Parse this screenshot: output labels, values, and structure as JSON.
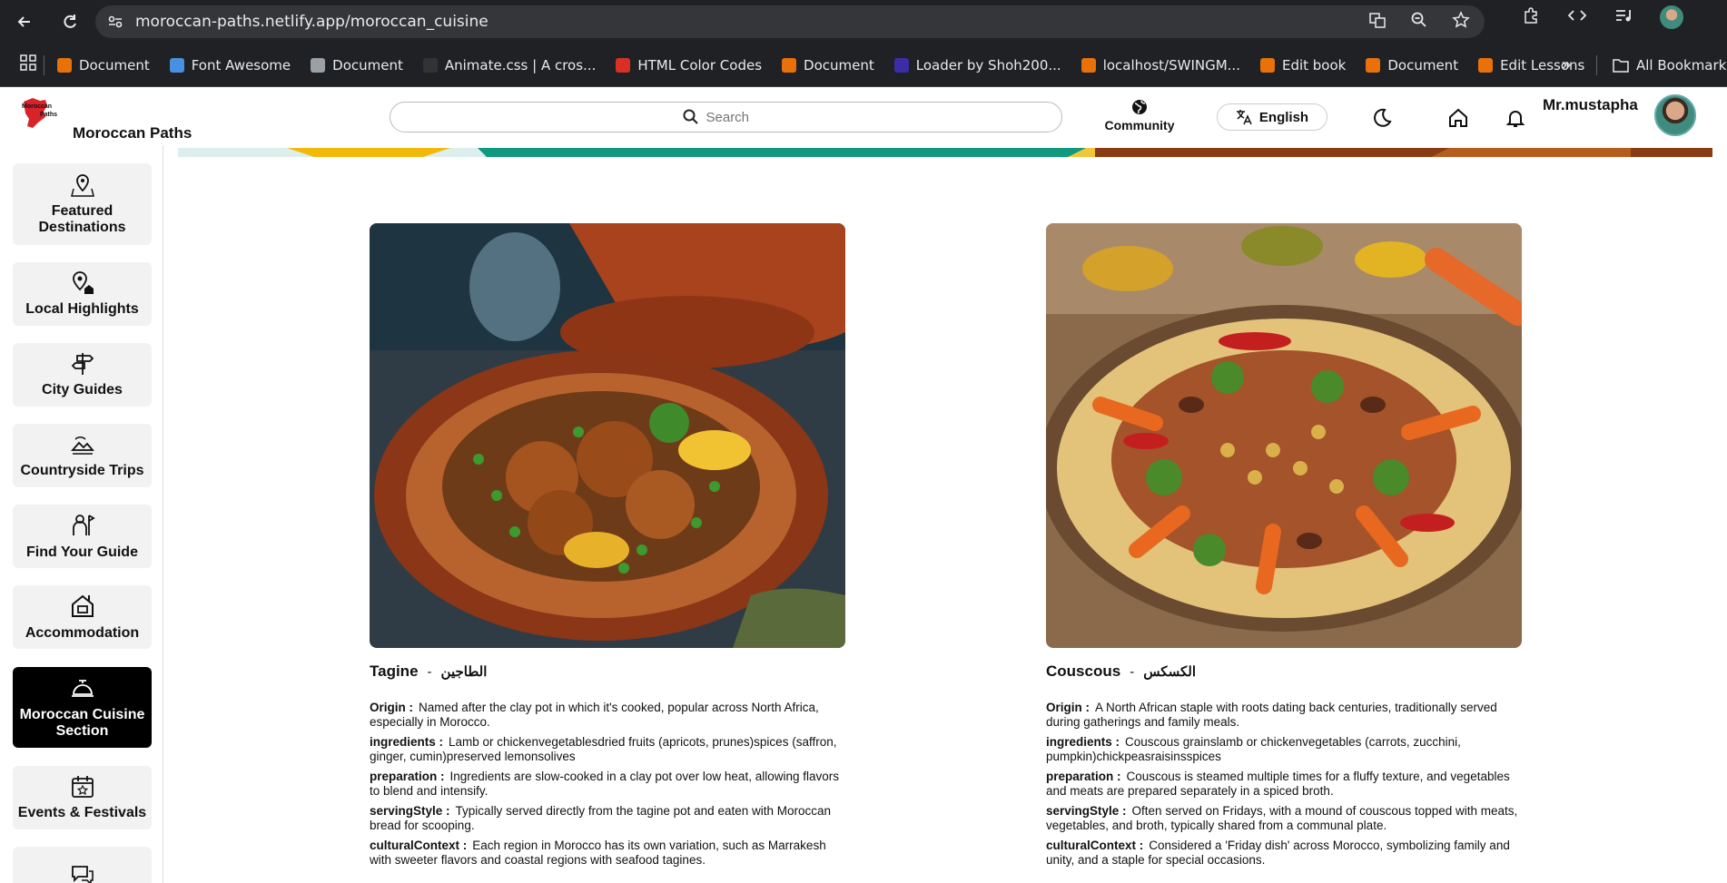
{
  "browser": {
    "url": "moroccan-paths.netlify.app/moroccan_cuisine",
    "bookmarks": [
      {
        "label": "Document",
        "color": "#e8710a"
      },
      {
        "label": "Font Awesome",
        "color": "#4a90e2"
      },
      {
        "label": "Document",
        "color": "#9aa0a6"
      },
      {
        "label": "Animate.css | A cros...",
        "color": "#333333"
      },
      {
        "label": "HTML Color Codes",
        "color": "#d93025"
      },
      {
        "label": "Document",
        "color": "#e8710a"
      },
      {
        "label": "Loader by Shoh200...",
        "color": "#3d2ca8"
      },
      {
        "label": "localhost/SWINGM...",
        "color": "#e8710a"
      },
      {
        "label": "Edit book",
        "color": "#e8710a"
      },
      {
        "label": "Document",
        "color": "#e8710a"
      },
      {
        "label": "Edit Lessons",
        "color": "#e8710a"
      }
    ],
    "all_bookmarks": "All Bookmarks"
  },
  "header": {
    "logo_text": "Moroccan Paths",
    "brand": "Moroccan Paths",
    "search_placeholder": "Search",
    "community": "Community",
    "language": "English",
    "username": "Mr.mustapha"
  },
  "sidebar": {
    "items": [
      {
        "label": "Featured Destinations",
        "icon": "map-pin-icon"
      },
      {
        "label": "Local Highlights",
        "icon": "location-home-icon"
      },
      {
        "label": "City Guides",
        "icon": "signpost-icon"
      },
      {
        "label": "Countryside Trips",
        "icon": "landscape-icon"
      },
      {
        "label": "Find Your Guide",
        "icon": "guide-icon"
      },
      {
        "label": "Accommodation",
        "icon": "house-icon"
      },
      {
        "label": "Moroccan Cuisine Section",
        "icon": "cloche-icon"
      },
      {
        "label": "Events & Festivals",
        "icon": "calendar-star-icon"
      }
    ]
  },
  "dishes": [
    {
      "name": "Tagine",
      "arabic": "الطاجين",
      "origin_label": "Origin :",
      "origin": "Named after the clay pot in which it's cooked, popular across North Africa, especially in Morocco.",
      "ingredients_label": "ingredients :",
      "ingredients": "Lamb or chickenvegetablesdried fruits (apricots, prunes)spices (saffron, ginger, cumin)preserved lemonsolives",
      "preparation_label": "preparation :",
      "preparation": "Ingredients are slow-cooked in a clay pot over low heat, allowing flavors to blend and intensify.",
      "serving_label": "servingStyle :",
      "serving": "Typically served directly from the tagine pot and eaten with Moroccan bread for scooping.",
      "cultural_label": "culturalContext :",
      "cultural": "Each region in Morocco has its own variation, such as Marrakesh with sweeter flavors and coastal regions with seafood tagines."
    },
    {
      "name": "Couscous",
      "arabic": "الكسكس",
      "origin_label": "Origin :",
      "origin": "A North African staple with roots dating back centuries, traditionally served during gatherings and family meals.",
      "ingredients_label": "ingredients :",
      "ingredients": "Couscous grainslamb or chickenvegetables (carrots, zucchini, pumpkin)chickpeasraisinsspices",
      "preparation_label": "preparation :",
      "preparation": "Couscous is steamed multiple times for a fluffy texture, and vegetables and meats are prepared separately in a spiced broth.",
      "serving_label": "servingStyle :",
      "serving": "Often served on Fridays, with a mound of couscous topped with meats, vegetables, and broth, typically shared from a communal plate.",
      "cultural_label": "culturalContext :",
      "cultural": "Considered a 'Friday dish' across Morocco, symbolizing family and unity, and a staple for special occasions."
    }
  ],
  "colors": {
    "active_sidebar": "#000000",
    "sidebar_item_bg": "#f2f2f2",
    "chrome_bg": "#202124",
    "omnibox_bg": "#35363a"
  }
}
